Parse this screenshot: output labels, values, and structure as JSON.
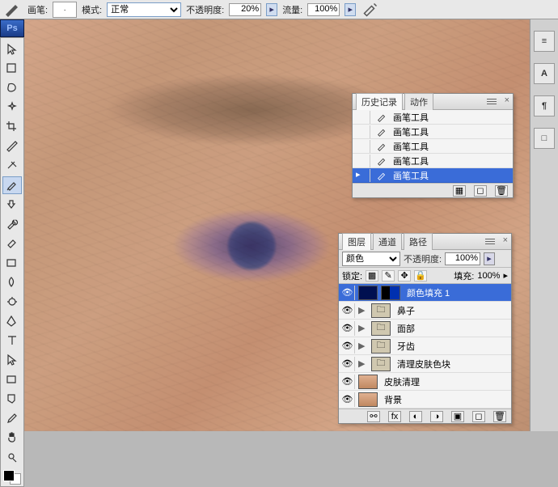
{
  "options": {
    "brush_label": "画笔:",
    "mode_label": "模式:",
    "mode_value": "正常",
    "opacity_label": "不透明度:",
    "opacity_value": "20%",
    "flow_label": "流量:",
    "flow_value": "100%"
  },
  "ps_logo": "Ps",
  "tools": [
    {
      "name": "move-tool"
    },
    {
      "name": "marquee-tool"
    },
    {
      "name": "lasso-tool"
    },
    {
      "name": "wand-tool"
    },
    {
      "name": "crop-tool"
    },
    {
      "name": "slice-tool"
    },
    {
      "name": "healing-tool"
    },
    {
      "name": "brush-tool",
      "active": true
    },
    {
      "name": "stamp-tool"
    },
    {
      "name": "history-brush-tool"
    },
    {
      "name": "eraser-tool"
    },
    {
      "name": "gradient-tool"
    },
    {
      "name": "blur-tool"
    },
    {
      "name": "dodge-tool"
    },
    {
      "name": "pen-tool"
    },
    {
      "name": "type-tool"
    },
    {
      "name": "path-select-tool"
    },
    {
      "name": "shape-tool"
    },
    {
      "name": "notes-tool"
    },
    {
      "name": "eyedropper-tool"
    },
    {
      "name": "hand-tool"
    },
    {
      "name": "zoom-tool"
    }
  ],
  "right_strip": {
    "items": [
      "≡",
      "A",
      "¶",
      "□"
    ]
  },
  "history_panel": {
    "tabs": [
      "历史记录",
      "动作"
    ],
    "active_tab": 0,
    "items": [
      {
        "label": "画笔工具"
      },
      {
        "label": "画笔工具"
      },
      {
        "label": "画笔工具"
      },
      {
        "label": "画笔工具"
      },
      {
        "label": "画笔工具",
        "selected": true
      }
    ]
  },
  "layers_panel": {
    "tabs": [
      "图层",
      "通道",
      "路径"
    ],
    "active_tab": 0,
    "blend_mode": "颜色",
    "opacity_label": "不透明度:",
    "opacity_value": "100%",
    "lock_label": "锁定:",
    "fill_label": "填充:",
    "fill_value": "100%",
    "layers": [
      {
        "name": "颜色填充 1",
        "type": "fill",
        "selected": true
      },
      {
        "name": "鼻子",
        "type": "group"
      },
      {
        "name": "面部",
        "type": "group"
      },
      {
        "name": "牙齿",
        "type": "group"
      },
      {
        "name": "清理皮肤色块",
        "type": "group"
      },
      {
        "name": "皮肤清理",
        "type": "image"
      },
      {
        "name": "背景",
        "type": "image"
      }
    ]
  }
}
